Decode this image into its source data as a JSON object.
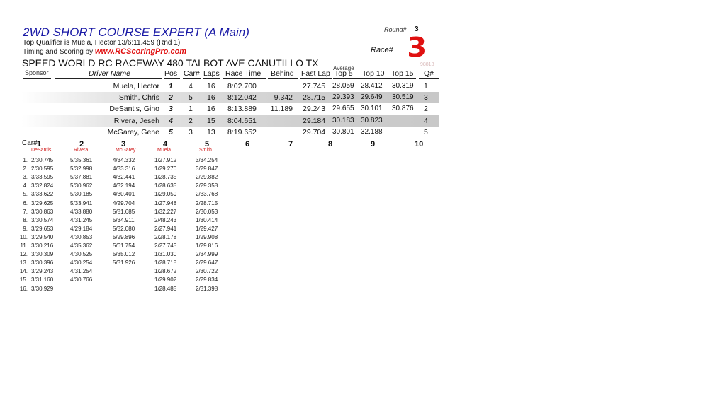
{
  "header": {
    "title": "2WD SHORT COURSE EXPERT (A Main)",
    "top_qualifier": "Top Qualifier is Muela, Hector 13/6:11.459 (Rnd 1)",
    "timing_prefix": "Timing and Scoring by ",
    "timing_link": "www.RCScoringPro.com",
    "round_label": "Round#",
    "round_value": "3",
    "race_label": "Race#",
    "race_value": "3",
    "code": "98818",
    "venue": "SPEED WORLD RC RACEWAY 480 TALBOT AVE CANUTILLO TX"
  },
  "results": {
    "average_label": "Average",
    "columns": {
      "sponsor": "Sponsor",
      "driver": "Driver Name",
      "pos": "Pos",
      "car": "Car#",
      "laps": "Laps",
      "race_time": "Race Time",
      "behind": "Behind",
      "fast_lap": "Fast Lap",
      "top5": "Top 5",
      "top10": "Top 10",
      "top15": "Top 15",
      "q": "Q#"
    },
    "rows": [
      {
        "driver": "Muela, Hector",
        "pos": "1",
        "car": "4",
        "laps": "16",
        "race_time": "8:02.700",
        "behind": "",
        "fast_lap": "27.745",
        "top5": "28.059",
        "top10": "28.412",
        "top15": "30.319",
        "q": "1"
      },
      {
        "driver": "Smith, Chris",
        "pos": "2",
        "car": "5",
        "laps": "16",
        "race_time": "8:12.042",
        "behind": "9.342",
        "fast_lap": "28.715",
        "top5": "29.393",
        "top10": "29.649",
        "top15": "30.519",
        "q": "3"
      },
      {
        "driver": "DeSantis, Gino",
        "pos": "3",
        "car": "1",
        "laps": "16",
        "race_time": "8:13.889",
        "behind": "11.189",
        "fast_lap": "29.243",
        "top5": "29.655",
        "top10": "30.101",
        "top15": "30.876",
        "q": "2"
      },
      {
        "driver": "Rivera, Jeseh",
        "pos": "4",
        "car": "2",
        "laps": "15",
        "race_time": "8:04.651",
        "behind": "",
        "fast_lap": "29.184",
        "top5": "30.183",
        "top10": "30.823",
        "top15": "",
        "q": "4"
      },
      {
        "driver": "McGarey, Gene",
        "pos": "5",
        "car": "3",
        "laps": "13",
        "race_time": "8:19.652",
        "behind": "",
        "fast_lap": "29.704",
        "top5": "30.801",
        "top10": "32.188",
        "top15": "",
        "q": "5"
      }
    ]
  },
  "lap_chart": {
    "car_label": "Car#",
    "cars": [
      {
        "num": "1",
        "driver": "DeSantis"
      },
      {
        "num": "2",
        "driver": "Rivera"
      },
      {
        "num": "3",
        "driver": "McGarey"
      },
      {
        "num": "4",
        "driver": "Muela"
      },
      {
        "num": "5",
        "driver": "Smith"
      },
      {
        "num": "6",
        "driver": ""
      },
      {
        "num": "7",
        "driver": ""
      },
      {
        "num": "8",
        "driver": ""
      },
      {
        "num": "9",
        "driver": ""
      },
      {
        "num": "10",
        "driver": ""
      }
    ],
    "laps": [
      {
        "lap": "1.",
        "times": [
          "2/30.745",
          "5/35.361",
          "4/34.332",
          "1/27.912",
          "3/34.254"
        ]
      },
      {
        "lap": "2.",
        "times": [
          "2/30.595",
          "5/32.998",
          "4/33.316",
          "1/29.270",
          "3/29.847"
        ]
      },
      {
        "lap": "3.",
        "times": [
          "3/33.595",
          "5/37.881",
          "4/32.441",
          "1/28.735",
          "2/29.882"
        ]
      },
      {
        "lap": "4.",
        "times": [
          "3/32.824",
          "5/30.962",
          "4/32.194",
          "1/28.635",
          "2/29.358"
        ]
      },
      {
        "lap": "5.",
        "times": [
          "3/33.622",
          "5/30.185",
          "4/30.401",
          "1/29.059",
          "2/33.768"
        ]
      },
      {
        "lap": "6.",
        "times": [
          "3/29.625",
          "5/33.941",
          "4/29.704",
          "1/27.948",
          "2/28.715"
        ]
      },
      {
        "lap": "7.",
        "times": [
          "3/30.863",
          "4/33.880",
          "5/81.685",
          "1/32.227",
          "2/30.053"
        ]
      },
      {
        "lap": "8.",
        "times": [
          "3/30.574",
          "4/31.245",
          "5/34.911",
          "2/48.243",
          "1/30.414"
        ]
      },
      {
        "lap": "9.",
        "times": [
          "3/29.653",
          "4/29.184",
          "5/32.080",
          "2/27.941",
          "1/29.427"
        ]
      },
      {
        "lap": "10.",
        "times": [
          "3/29.540",
          "4/30.853",
          "5/29.896",
          "2/28.178",
          "1/29.908"
        ]
      },
      {
        "lap": "11.",
        "times": [
          "3/30.216",
          "4/35.362",
          "5/61.754",
          "2/27.745",
          "1/29.816"
        ]
      },
      {
        "lap": "12.",
        "times": [
          "3/30.309",
          "4/30.525",
          "5/35.012",
          "1/31.030",
          "2/34.999"
        ]
      },
      {
        "lap": "13.",
        "times": [
          "3/30.396",
          "4/30.254",
          "5/31.926",
          "1/28.718",
          "2/29.647"
        ]
      },
      {
        "lap": "14.",
        "times": [
          "3/29.243",
          "4/31.254",
          "",
          "1/28.672",
          "2/30.722"
        ]
      },
      {
        "lap": "15.",
        "times": [
          "3/31.160",
          "4/30.766",
          "",
          "1/29.902",
          "2/29.834"
        ]
      },
      {
        "lap": "16.",
        "times": [
          "3/30.929",
          "",
          "",
          "1/28.485",
          "2/31.398"
        ]
      }
    ]
  }
}
